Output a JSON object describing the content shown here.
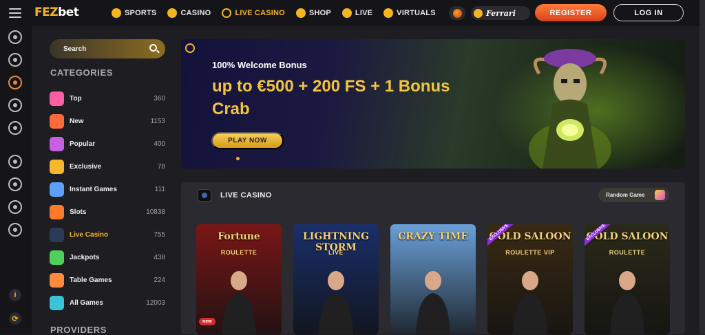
{
  "brand": {
    "fez": "FEZ",
    "bet": "bet"
  },
  "nav": [
    {
      "label": "SPORTS"
    },
    {
      "label": "CASINO"
    },
    {
      "label": "LIVE CASINO"
    },
    {
      "label": "SHOP"
    },
    {
      "label": "LIVE"
    },
    {
      "label": "VIRTUALS"
    }
  ],
  "sponsor": {
    "ferrari": "Ferrari"
  },
  "auth": {
    "register": "REGISTER",
    "login": "LOG IN"
  },
  "rail": {
    "info": "i"
  },
  "search": {
    "label": "Search"
  },
  "categories": {
    "title": "CATEGORIES",
    "items": [
      {
        "label": "Top",
        "count": "360",
        "color": "#ff5fa2"
      },
      {
        "label": "New",
        "count": "1153",
        "color": "#ff6a3a"
      },
      {
        "label": "Popular",
        "count": "400",
        "color": "#c65fe0"
      },
      {
        "label": "Exclusive",
        "count": "78",
        "color": "#f5b82a"
      },
      {
        "label": "Instant Games",
        "count": "111",
        "color": "#5aa0ff"
      },
      {
        "label": "Slots",
        "count": "10838",
        "color": "#ff7a2a"
      },
      {
        "label": "Live Casino",
        "count": "755",
        "color": "#2a3a5a"
      },
      {
        "label": "Jackpots",
        "count": "438",
        "color": "#4fd05a"
      },
      {
        "label": "Table Games",
        "count": "224",
        "color": "#ff8a3a"
      },
      {
        "label": "All Games",
        "count": "12003",
        "color": "#3ac4d9"
      }
    ]
  },
  "providers": {
    "title": "PROVIDERS"
  },
  "banner": {
    "subtitle": "100% Welcome Bonus",
    "headline": "up to €500 + 200 FS + 1 Bonus Crab",
    "cta": "PLAY NOW"
  },
  "live_casino": {
    "title": "LIVE CASINO",
    "random_label": "Random Game",
    "games": [
      {
        "title": "Fortune",
        "sub": "ROULETTE",
        "badge": "new",
        "bg": "#7a1616"
      },
      {
        "title": "LIGHTNING STORM",
        "sub": "LIVE",
        "badge": "",
        "bg": "#1a2f6a"
      },
      {
        "title": "CRAZY TIME",
        "sub": "",
        "badge": "",
        "bg": "#6aa0d8"
      },
      {
        "title": "GOLD SALOON",
        "sub": "ROULETTE VIP",
        "badge": "EXCLUSIVE",
        "bg": "#3a2a14"
      },
      {
        "title": "GOLD SALOON",
        "sub": "ROULETTE",
        "badge": "EXCLUSIVE",
        "bg": "#2a2a1a"
      }
    ]
  }
}
